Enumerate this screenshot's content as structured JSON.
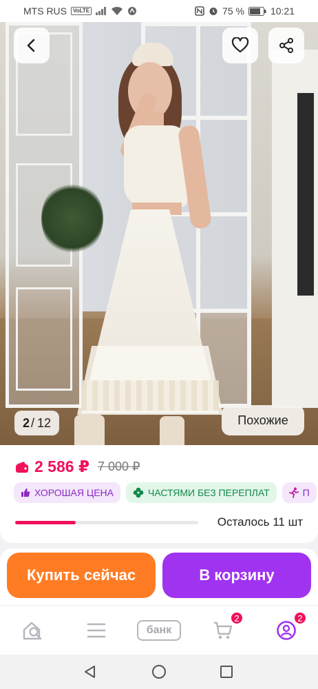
{
  "status_bar": {
    "carrier": "MTS RUS",
    "volte": "VoLTE",
    "battery": "75 %",
    "time": "10:21"
  },
  "gallery": {
    "current_index": "2",
    "separator": "/",
    "total": "12",
    "similar_label": "Похожие"
  },
  "product": {
    "price": "2 586 ₽",
    "old_price": "7 000 ₽",
    "badges": [
      {
        "label": "ХОРОШАЯ ЦЕНА",
        "icon": "thumbs-up-icon"
      },
      {
        "label": "ЧАСТЯМИ БЕЗ ПЕРЕПЛАТ",
        "icon": "clover-icon"
      },
      {
        "label": "П",
        "icon": "runner-icon"
      }
    ],
    "stock_text": "Осталось 11 шт",
    "stock_fraction": 0.33
  },
  "actions": {
    "buy_now": "Купить сейчас",
    "add_to_cart": "В корзину"
  },
  "bottom_nav": {
    "bank_label": "банк",
    "cart_badge": "2",
    "profile_badge": "2"
  },
  "colors": {
    "accent_price": "#f0115a",
    "buy_button": "#ff7c25",
    "cart_button": "#a033f0"
  }
}
